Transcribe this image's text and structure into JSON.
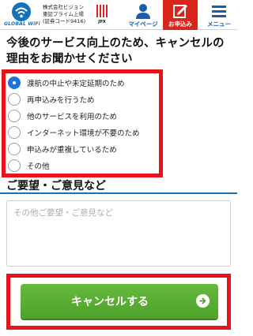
{
  "header": {
    "logo_text": "GLOBAL WiFi",
    "company_lines": [
      "株式会社ビジョン",
      "東証プライム上場",
      "(証券コード9416)"
    ],
    "jpx_label": "JPX",
    "nav": {
      "mypage": "マイページ",
      "apply": "お申込み",
      "menu": "メニュー"
    }
  },
  "title": "今後のサービス向上のため、キャンセルの理由をお聞かせください",
  "reasons": [
    {
      "label": "渡航の中止や未定延期のため",
      "checked": true
    },
    {
      "label": "再申込みを行うため",
      "checked": false
    },
    {
      "label": "他のサービスを利用のため",
      "checked": false
    },
    {
      "label": "インターネット環境が不要のため",
      "checked": false
    },
    {
      "label": "申込みが重複しているため",
      "checked": false
    },
    {
      "label": "その他",
      "checked": false
    }
  ],
  "comment": {
    "title": "ご要望・ご意見など",
    "placeholder": "その他ご要望・ご意見など"
  },
  "cancel_button": {
    "label": "キャンセルする"
  },
  "colors": {
    "brand_blue": "#1672b8",
    "apply_red": "#d9261c",
    "highlight_red": "#e8141b",
    "button_green": "#58ae33",
    "radio_selected": "#1e73d9"
  }
}
